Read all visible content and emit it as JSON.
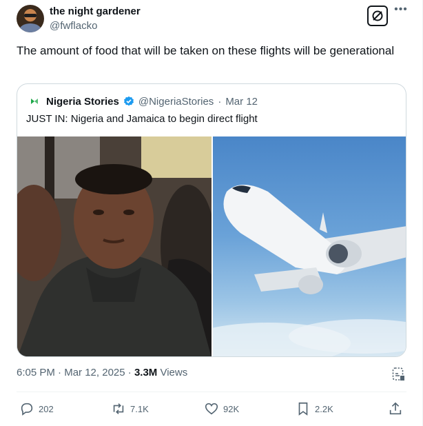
{
  "author": {
    "name": "the night gardener",
    "handle": "@fwflacko"
  },
  "tweet": {
    "text": "The amount of food that will be taken on these flights will be generational"
  },
  "quoted": {
    "name": "Nigeria Stories",
    "handle": "@NigeriaStories",
    "separator": "·",
    "date": "Mar 12",
    "text": "JUST IN: Nigeria and Jamaica to begin direct flight"
  },
  "meta": {
    "time": "6:05 PM",
    "separator": "·",
    "date": "Mar 12, 2025",
    "views_count": "3.3M",
    "views_label": "Views"
  },
  "actions": {
    "replies": "202",
    "reposts": "7.1K",
    "likes": "92K",
    "bookmarks": "2.2K"
  },
  "colors": {
    "text_primary": "#0f1419",
    "text_secondary": "#536471",
    "border": "#cfd9de",
    "verified": "#1d9bf0",
    "nigeria_green": "#1fa84a"
  },
  "icons": {
    "more": "more-horizontal-icon",
    "grok": "grok-icon",
    "reply": "reply-icon",
    "repost": "repost-icon",
    "like": "heart-icon",
    "bookmark": "bookmark-icon",
    "share": "share-icon",
    "views_chart": "analytics-icon"
  }
}
